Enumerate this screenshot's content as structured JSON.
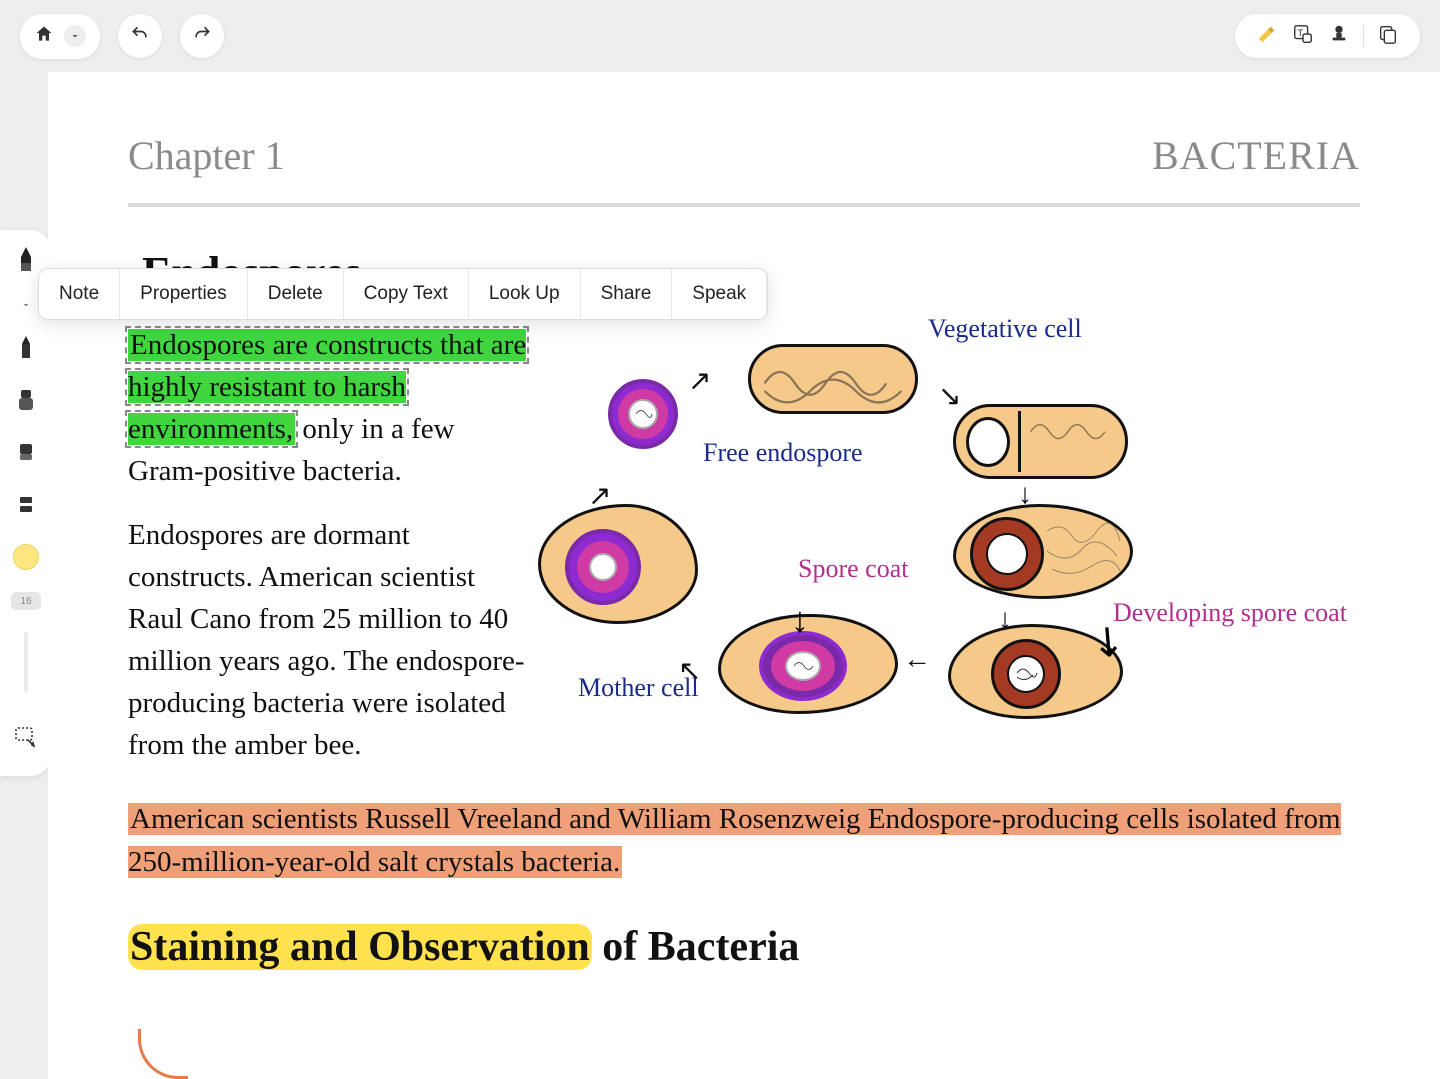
{
  "toolbar": {
    "home": "home",
    "dropdown": "chevron-down",
    "undo": "undo",
    "redo": "redo",
    "right_icons": [
      "highlighter-icon",
      "text-tool-icon",
      "stamp-icon",
      "pages-icon"
    ]
  },
  "context_menu": {
    "items": [
      "Note",
      "Properties",
      "Delete",
      "Copy Text",
      "Look Up",
      "Share",
      "Speak"
    ]
  },
  "tool_dock": {
    "tools": [
      "pen-icon",
      "chevron-down-icon",
      "pencil-icon",
      "marker-icon",
      "eraser-icon",
      "ruler-icon"
    ],
    "color": "#ffe680",
    "size_label": "16",
    "lasso": "lasso-select-icon"
  },
  "page": {
    "chapter_label": "Chapter 1",
    "chapter_topic": "BACTERIA",
    "section_title": "Endospores",
    "para1_hl": "Endospores are constructs that are highly resistant to harsh environments,",
    "para1_rest": " only in a few Gram-positive bacteria.",
    "para2": "Endospores are dormant constructs. American scientist Raul Cano from 25 million to 40 million years ago. The endospore-producing bacteria were isolated from the amber bee.",
    "para3_hl": "American scientists Russell Vreeland and William Rosenzweig Endospore-producing cells isolated from 250-million-year-old salt crystals bacteria.",
    "heading2_hl": "Staining and Observation",
    "heading2_rest": " of Bacteria"
  },
  "diagram": {
    "labels": {
      "vegetative_cell": "Vegetative cell",
      "free_endospore": "Free endospore",
      "spore_coat": "Spore coat",
      "developing_spore_coat": "Developing spore coat",
      "mother_cell": "Mother cell"
    }
  }
}
